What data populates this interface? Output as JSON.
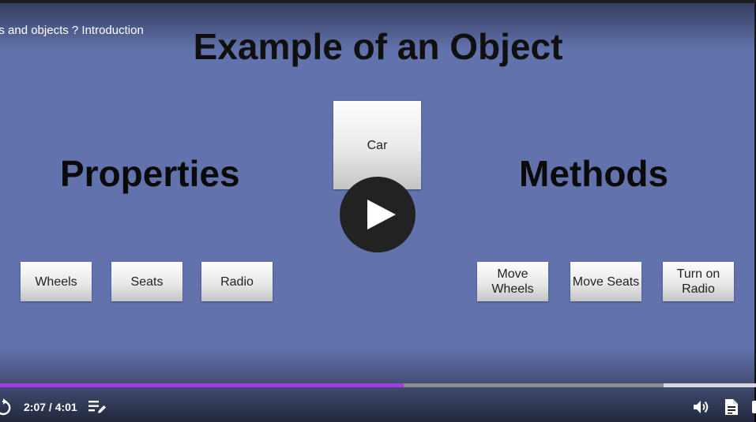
{
  "video": {
    "title": "es and objects ? Introduction"
  },
  "slide": {
    "heading": "Example of an Object",
    "center_box": "Car",
    "properties": {
      "heading": "Properties",
      "items": [
        "Wheels",
        "Seats",
        "Radio"
      ]
    },
    "methods": {
      "heading": "Methods",
      "items": [
        "Move\nWheels",
        "Move Seats",
        "Turn on\nRadio"
      ]
    }
  },
  "player": {
    "current_time": "2:07",
    "duration": "4:01",
    "time_display": "2:07 / 4:01",
    "played_fraction": 0.534,
    "loaded_fraction": 0.878,
    "accent_color": "#a23cdc",
    "icons": {
      "replay": "replay-icon",
      "play": "play-icon",
      "playlist": "playlist-edit-icon",
      "volume": "volume-icon",
      "transcript": "transcript-icon"
    }
  }
}
